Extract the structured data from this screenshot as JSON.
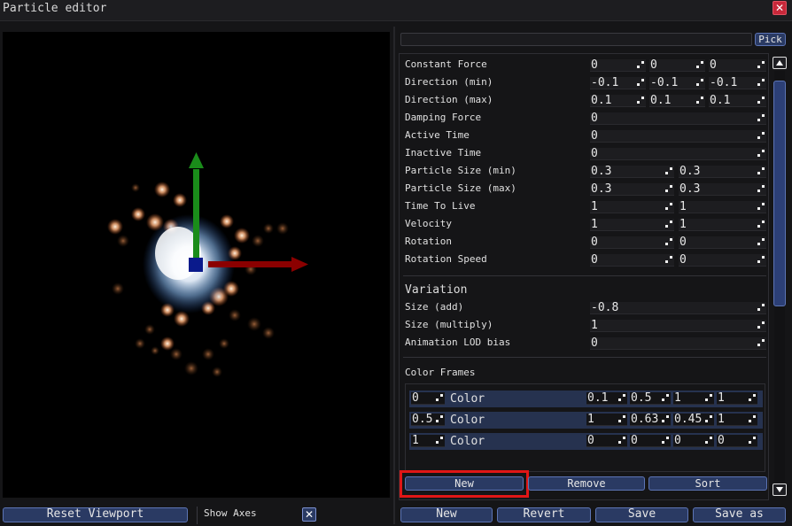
{
  "window": {
    "title": "Particle editor"
  },
  "viewport": {
    "reset_label": "Reset Viewport",
    "show_axes_label": "Show Axes",
    "show_axes_checked": true
  },
  "top": {
    "pick_label": "Pick"
  },
  "properties": [
    {
      "label": "Constant Force",
      "values": [
        "0",
        "0",
        "0"
      ]
    },
    {
      "label": "Direction (min)",
      "values": [
        "-0.1",
        "-0.1",
        "-0.1"
      ]
    },
    {
      "label": "Direction (max)",
      "values": [
        "0.1",
        "0.1",
        "0.1"
      ]
    },
    {
      "label": "Damping Force",
      "values": [
        "0"
      ]
    },
    {
      "label": "Active Time",
      "values": [
        "0"
      ]
    },
    {
      "label": "Inactive Time",
      "values": [
        "0"
      ]
    },
    {
      "label": "Particle Size (min)",
      "values": [
        "0.3",
        "0.3"
      ]
    },
    {
      "label": "Particle Size (max)",
      "values": [
        "0.3",
        "0.3"
      ]
    },
    {
      "label": "Time To Live",
      "values": [
        "1",
        "1"
      ]
    },
    {
      "label": "Velocity",
      "values": [
        "1",
        "1"
      ]
    },
    {
      "label": "Rotation",
      "values": [
        "0",
        "0"
      ]
    },
    {
      "label": "Rotation Speed",
      "values": [
        "0",
        "0"
      ]
    }
  ],
  "variation": {
    "heading": "Variation",
    "rows": [
      {
        "label": "Size (add)",
        "value": "-0.8"
      },
      {
        "label": "Size (multiply)",
        "value": "1"
      },
      {
        "label": "Animation LOD bias",
        "value": "0"
      }
    ]
  },
  "color_frames": {
    "heading": "Color Frames",
    "color_label": "Color",
    "frames": [
      {
        "time": "0",
        "rgba": [
          "0.1",
          "0.5",
          "1",
          "1"
        ]
      },
      {
        "time": "0.5",
        "rgba": [
          "1",
          "0.63",
          "0.45",
          "1"
        ]
      },
      {
        "time": "1",
        "rgba": [
          "0",
          "0",
          "0",
          "0"
        ]
      }
    ],
    "new_label": "New",
    "remove_label": "Remove",
    "sort_label": "Sort"
  },
  "footer": {
    "new_label": "New",
    "revert_label": "Revert",
    "save_label": "Save",
    "save_as_label": "Save as"
  },
  "colors": {
    "accent": "#2a3a63",
    "highlight": "#e01616",
    "axis_x": "#8b0000",
    "axis_y": "#1a8c1a",
    "axis_origin": "#0a1a8c"
  }
}
